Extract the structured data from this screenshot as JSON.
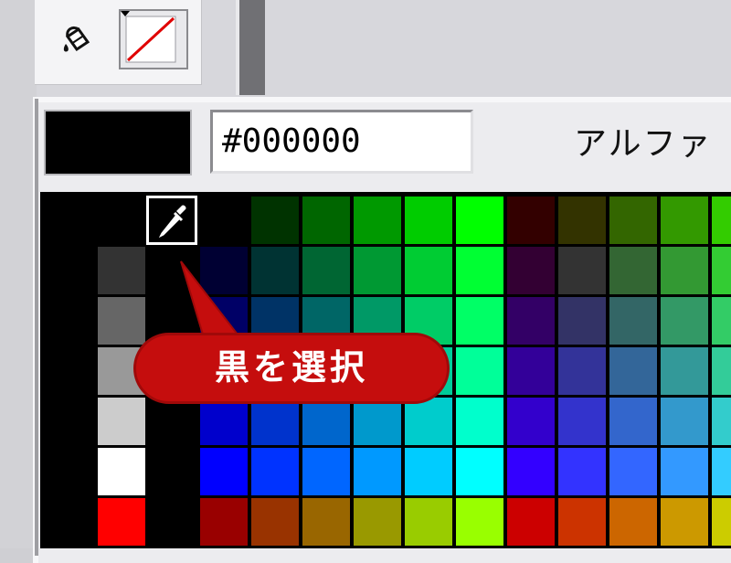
{
  "toolbar": {
    "fill_tool_icon": "paint-bucket-icon",
    "stroke_color_icon": "no-color-slash-icon"
  },
  "picker": {
    "current_color": "#000000",
    "hex_value": "#000000",
    "alpha_label": "アルファ"
  },
  "callout": {
    "text": "黒を選択"
  },
  "palette": {
    "left_column": [
      "#000000",
      "#333333",
      "#666666",
      "#999999",
      "#cccccc",
      "#ffffff",
      "#ff0000"
    ],
    "grid": [
      [
        "#000000",
        "#003300",
        "#006600",
        "#009900",
        "#00cc00",
        "#00ff00",
        "#330000",
        "#333300",
        "#336600",
        "#339900",
        "#33cc00"
      ],
      [
        "#000033",
        "#003333",
        "#006633",
        "#009933",
        "#00cc33",
        "#00ff33",
        "#330033",
        "#333333",
        "#336633",
        "#339933",
        "#33cc33"
      ],
      [
        "#000066",
        "#003366",
        "#006666",
        "#009966",
        "#00cc66",
        "#00ff66",
        "#330066",
        "#333366",
        "#336666",
        "#339966",
        "#33cc66"
      ],
      [
        "#000099",
        "#003399",
        "#006699",
        "#009999",
        "#00cc99",
        "#00ff99",
        "#330099",
        "#333399",
        "#336699",
        "#339999",
        "#33cc99"
      ],
      [
        "#0000cc",
        "#0033cc",
        "#0066cc",
        "#0099cc",
        "#00cccc",
        "#00ffcc",
        "#3300cc",
        "#3333cc",
        "#3366cc",
        "#3399cc",
        "#33cccc"
      ],
      [
        "#0000ff",
        "#0033ff",
        "#0066ff",
        "#0099ff",
        "#00ccff",
        "#00ffff",
        "#3300ff",
        "#3333ff",
        "#3366ff",
        "#3399ff",
        "#33ccff"
      ],
      [
        "#990000",
        "#993300",
        "#996600",
        "#999900",
        "#99cc00",
        "#99ff00",
        "#cc0000",
        "#cc3300",
        "#cc6600",
        "#cc9900",
        "#cccc00"
      ]
    ]
  },
  "colors": {
    "callout_red": "#c50d0d",
    "selection_outline": "#ffffff"
  }
}
